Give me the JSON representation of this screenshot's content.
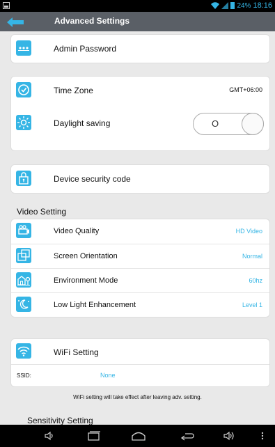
{
  "status_bar": {
    "battery": "24%",
    "time": "18:16",
    "icons": [
      "screenshot-icon",
      "wifi-icon",
      "signal-icon",
      "battery-icon"
    ]
  },
  "header": {
    "title": "Advanced Settings"
  },
  "admin": {
    "label": "Admin Password"
  },
  "time_card": {
    "timezone_label": "Time Zone",
    "timezone_value": "GMT+06:00",
    "daylight_label": "Daylight saving",
    "daylight_toggle": "O"
  },
  "security": {
    "label": "Device security code"
  },
  "video": {
    "heading": "Video Setting",
    "items": [
      {
        "label": "Video Quality",
        "value": "HD Video"
      },
      {
        "label": "Screen Orientation",
        "value": "Normal"
      },
      {
        "label": "Environment Mode",
        "value": "60hz"
      },
      {
        "label": "Low Light Enhancement",
        "value": "Level 1"
      }
    ]
  },
  "wifi": {
    "label": "WiFi Setting",
    "ssid_label": "SSID:",
    "ssid_value": "None",
    "note": "WiFi setting will take effect after leaving adv. setting."
  },
  "sensitivity": {
    "heading": "Sensitivity Setting"
  },
  "colors": {
    "accent": "#35b5e5",
    "title_bar": "#5a5f66",
    "background": "#e9e9e9"
  }
}
